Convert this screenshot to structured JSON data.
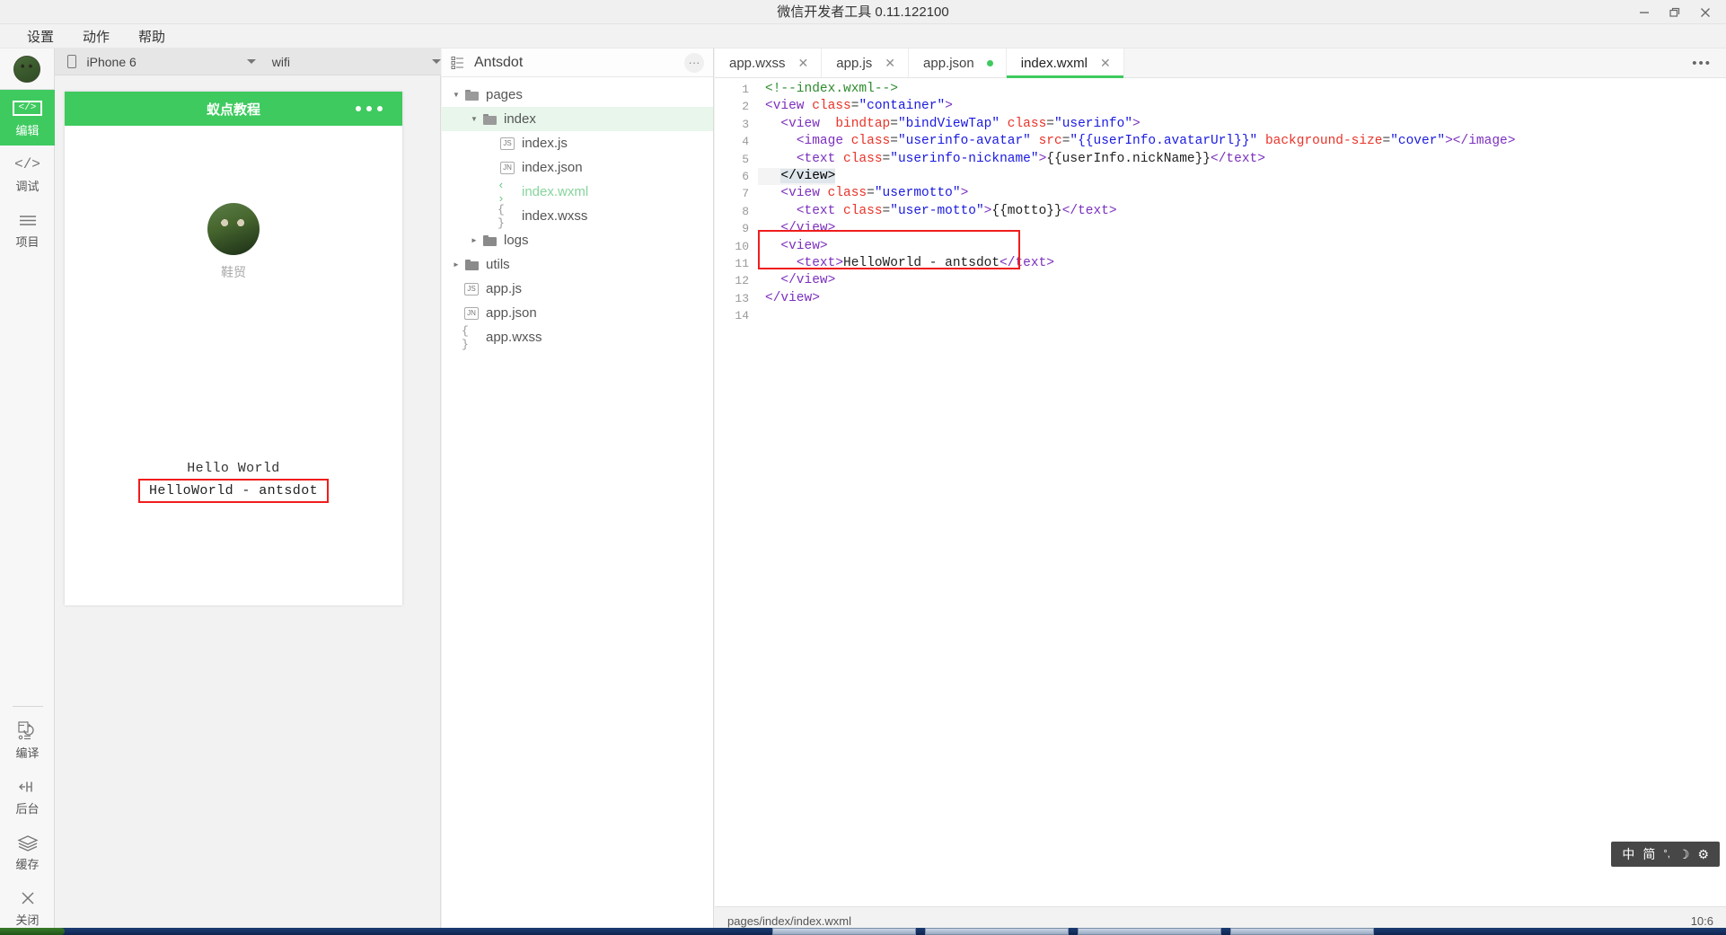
{
  "window": {
    "title": "微信开发者工具 0.11.122100",
    "minimize_label": "—",
    "maximize_label": "❐",
    "close_label": "✕"
  },
  "menubar": {
    "items": [
      {
        "label": "设置",
        "name": "menu-settings"
      },
      {
        "label": "动作",
        "name": "menu-actions"
      },
      {
        "label": "帮助",
        "name": "menu-help"
      }
    ]
  },
  "activitybar": {
    "top_items": [
      {
        "label": "编辑",
        "icon": "code-box-icon",
        "active": true
      },
      {
        "label": "调试",
        "icon": "angle-brackets-icon",
        "active": false
      },
      {
        "label": "项目",
        "icon": "lines-icon",
        "active": false
      }
    ],
    "bottom_items": [
      {
        "label": "编译",
        "icon": "compile-refresh-icon"
      },
      {
        "label": "后台",
        "icon": "background-icon"
      },
      {
        "label": "缓存",
        "icon": "layers-icon"
      },
      {
        "label": "关闭",
        "icon": "close-x-icon"
      }
    ]
  },
  "simulator": {
    "device": "iPhone 6",
    "network": "wifi",
    "phone": {
      "title": "蚁点教程",
      "menu_dots": "•••",
      "nickname": "鞋贸",
      "motto": "Hello World",
      "highlighted_text": "HelloWorld - antsdot"
    }
  },
  "filetree": {
    "project_name": "Antsdot",
    "more_label": "···",
    "nodes": [
      {
        "label": "pages",
        "depth": 0,
        "type": "folder",
        "expanded": true,
        "selected": false,
        "icon": "folder-open-icon"
      },
      {
        "label": "index",
        "depth": 1,
        "type": "folder",
        "expanded": true,
        "selected": true,
        "icon": "folder-open-icon"
      },
      {
        "label": "index.js",
        "depth": 2,
        "type": "js",
        "expanded": null,
        "selected": false,
        "icon": "js-badge-icon"
      },
      {
        "label": "index.json",
        "depth": 2,
        "type": "json",
        "expanded": null,
        "selected": false,
        "icon": "jn-badge-icon"
      },
      {
        "label": "index.wxml",
        "depth": 2,
        "type": "wxml",
        "expanded": null,
        "selected": false,
        "icon": "angle-brackets-icon"
      },
      {
        "label": "index.wxss",
        "depth": 2,
        "type": "wxss",
        "expanded": null,
        "selected": false,
        "icon": "braces-icon"
      },
      {
        "label": "logs",
        "depth": 1,
        "type": "folder",
        "expanded": false,
        "selected": false,
        "icon": "folder-closed-icon"
      },
      {
        "label": "utils",
        "depth": 0,
        "type": "folder",
        "expanded": false,
        "selected": false,
        "icon": "folder-closed-icon"
      },
      {
        "label": "app.js",
        "depth": 0,
        "type": "js",
        "expanded": null,
        "selected": false,
        "icon": "js-badge-icon"
      },
      {
        "label": "app.json",
        "depth": 0,
        "type": "json",
        "expanded": null,
        "selected": false,
        "icon": "jn-badge-icon"
      },
      {
        "label": "app.wxss",
        "depth": 0,
        "type": "wxss",
        "expanded": null,
        "selected": false,
        "icon": "braces-icon"
      }
    ]
  },
  "editor": {
    "tabs": [
      {
        "label": "app.wxss",
        "active": false,
        "modified": false,
        "close": "✕"
      },
      {
        "label": "app.js",
        "active": false,
        "modified": false,
        "close": "✕"
      },
      {
        "label": "app.json",
        "active": false,
        "modified": true,
        "close": ""
      },
      {
        "label": "index.wxml",
        "active": true,
        "modified": false,
        "close": "✕"
      }
    ],
    "more_label": "•••",
    "lines": [
      {
        "n": 1,
        "cursor": false,
        "tokens": [
          {
            "t": "cmt",
            "v": "<!--index.wxml-->"
          }
        ]
      },
      {
        "n": 2,
        "cursor": false,
        "tokens": [
          {
            "t": "tag",
            "v": "<view "
          },
          {
            "t": "attr",
            "v": "class"
          },
          {
            "t": "punc",
            "v": "="
          },
          {
            "t": "str",
            "v": "\"container\""
          },
          {
            "t": "tag",
            "v": ">"
          }
        ]
      },
      {
        "n": 3,
        "cursor": false,
        "tokens": [
          {
            "t": "punc",
            "v": "  "
          },
          {
            "t": "tag",
            "v": "<view  "
          },
          {
            "t": "attr",
            "v": "bindtap"
          },
          {
            "t": "punc",
            "v": "="
          },
          {
            "t": "str",
            "v": "\"bindViewTap\""
          },
          {
            "t": "punc",
            "v": " "
          },
          {
            "t": "attr",
            "v": "class"
          },
          {
            "t": "punc",
            "v": "="
          },
          {
            "t": "str",
            "v": "\"userinfo\""
          },
          {
            "t": "tag",
            "v": ">"
          }
        ]
      },
      {
        "n": 4,
        "cursor": false,
        "tokens": [
          {
            "t": "punc",
            "v": "    "
          },
          {
            "t": "tag",
            "v": "<image "
          },
          {
            "t": "attr",
            "v": "class"
          },
          {
            "t": "punc",
            "v": "="
          },
          {
            "t": "str",
            "v": "\"userinfo-avatar\""
          },
          {
            "t": "punc",
            "v": " "
          },
          {
            "t": "attr",
            "v": "src"
          },
          {
            "t": "punc",
            "v": "="
          },
          {
            "t": "str",
            "v": "\"{{userInfo.avatarUrl}}\""
          },
          {
            "t": "punc",
            "v": " "
          },
          {
            "t": "attr",
            "v": "background-size"
          },
          {
            "t": "punc",
            "v": "="
          },
          {
            "t": "str",
            "v": "\"cover\""
          },
          {
            "t": "tag",
            "v": "></image>"
          }
        ]
      },
      {
        "n": 5,
        "cursor": false,
        "tokens": [
          {
            "t": "punc",
            "v": "    "
          },
          {
            "t": "tag",
            "v": "<text "
          },
          {
            "t": "attr",
            "v": "class"
          },
          {
            "t": "punc",
            "v": "="
          },
          {
            "t": "str",
            "v": "\"userinfo-nickname\""
          },
          {
            "t": "tag",
            "v": ">"
          },
          {
            "t": "txt",
            "v": "{{userInfo.nickName}}"
          },
          {
            "t": "tag",
            "v": "</text>"
          }
        ]
      },
      {
        "n": 6,
        "cursor": true,
        "tokens": [
          {
            "t": "punc",
            "v": "  "
          },
          {
            "t": "brc",
            "v": "</view>"
          }
        ]
      },
      {
        "n": 7,
        "cursor": false,
        "tokens": [
          {
            "t": "punc",
            "v": "  "
          },
          {
            "t": "tag",
            "v": "<view "
          },
          {
            "t": "attr",
            "v": "class"
          },
          {
            "t": "punc",
            "v": "="
          },
          {
            "t": "str",
            "v": "\"usermotto\""
          },
          {
            "t": "tag",
            "v": ">"
          }
        ]
      },
      {
        "n": 8,
        "cursor": false,
        "tokens": [
          {
            "t": "punc",
            "v": "    "
          },
          {
            "t": "tag",
            "v": "<text "
          },
          {
            "t": "attr",
            "v": "class"
          },
          {
            "t": "punc",
            "v": "="
          },
          {
            "t": "str",
            "v": "\"user-motto\""
          },
          {
            "t": "tag",
            "v": ">"
          },
          {
            "t": "txt",
            "v": "{{motto}}"
          },
          {
            "t": "tag",
            "v": "</text>"
          }
        ]
      },
      {
        "n": 9,
        "cursor": false,
        "tokens": [
          {
            "t": "punc",
            "v": "  "
          },
          {
            "t": "tag",
            "v": "</view>"
          }
        ]
      },
      {
        "n": 10,
        "cursor": false,
        "tokens": [
          {
            "t": "punc",
            "v": "  "
          },
          {
            "t": "tag",
            "v": "<view>"
          }
        ]
      },
      {
        "n": 11,
        "cursor": false,
        "tokens": [
          {
            "t": "punc",
            "v": "    "
          },
          {
            "t": "tag",
            "v": "<text>"
          },
          {
            "t": "txt",
            "v": "HelloWorld - antsdot"
          },
          {
            "t": "tag",
            "v": "</text>"
          }
        ]
      },
      {
        "n": 12,
        "cursor": false,
        "tokens": [
          {
            "t": "punc",
            "v": "  "
          },
          {
            "t": "tag",
            "v": "</view>"
          }
        ]
      },
      {
        "n": 13,
        "cursor": false,
        "tokens": [
          {
            "t": "tag",
            "v": "</view>"
          }
        ]
      },
      {
        "n": 14,
        "cursor": false,
        "tokens": []
      }
    ]
  },
  "statusbar": {
    "path": "pages/index/index.wxml",
    "position": "10:6"
  },
  "ime": {
    "lang": "中",
    "mode": "简",
    "punct": "°,",
    "moon": "☽",
    "gear": "⚙"
  },
  "colors": {
    "accent_green": "#3eca5f",
    "highlight_red": "#f01d1d",
    "tag_purple": "#7b2fbe",
    "attr_red": "#e8342a",
    "string_blue": "#1a1ae0",
    "comment_green": "#2e8b2e"
  }
}
